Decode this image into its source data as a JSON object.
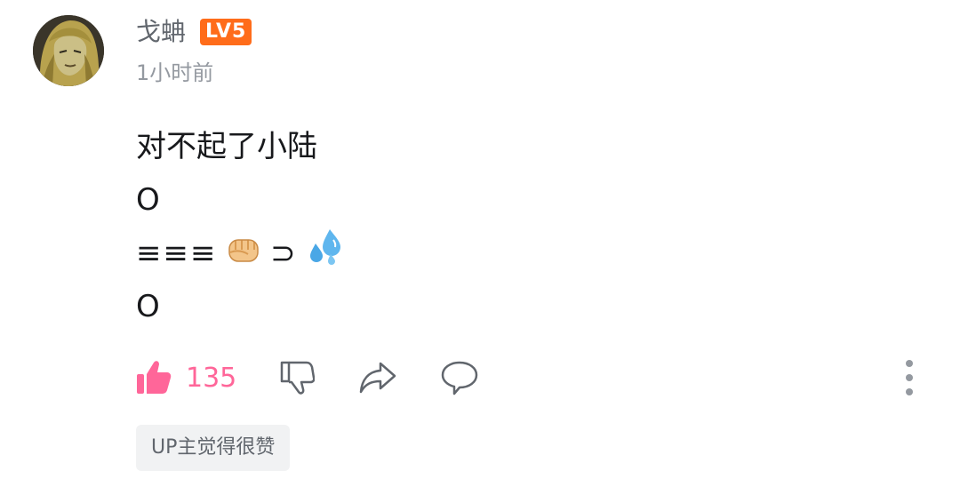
{
  "comment": {
    "username": "戈蚺",
    "level": "LV5",
    "timestamp": "1小时前",
    "content_lines": [
      "对不起了小陆",
      "O",
      "≡≡≡",
      "⊃",
      "O"
    ],
    "like_count": "135",
    "up_badge": "UP主觉得很赞"
  },
  "colors": {
    "like_accent": "#ff6699",
    "level_badge": "#ff6c1a",
    "secondary_text": "#9499a0"
  },
  "icons": [
    "avatar",
    "thumbs-up-icon",
    "thumbs-down-icon",
    "share-icon",
    "reply-icon",
    "more-icon",
    "fist-icon",
    "sweat-droplets-icon"
  ]
}
